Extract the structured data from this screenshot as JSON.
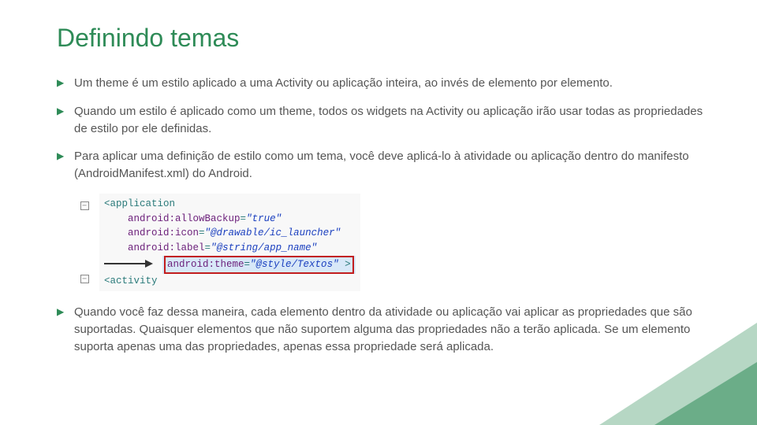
{
  "title": "Definindo temas",
  "bullets": {
    "b1": "Um theme é um estilo aplicado a uma Activity ou aplicação inteira, ao invés de elemento por elemento.",
    "b2": "Quando um estilo é aplicado como um theme, todos os widgets na Activity ou aplicação irão usar todas as propriedades de estilo por ele definidas.",
    "b3": "Para aplicar uma definição de estilo como um tema, você deve aplicá-lo à atividade ou aplicação dentro do manifesto (AndroidManifest.xml) do Android.",
    "b4": "Quando você faz dessa maneira, cada elemento dentro da atividade ou aplicação vai aplicar as propriedades que são suportadas. Quaisquer elementos que não suportem alguma das propriedades não a terão aplicada. Se um elemento suporta apenas uma das propriedades, apenas essa propriedade será aplicada."
  },
  "code": {
    "application_open": "<application",
    "allow_backup_attr": "android:allowBackup",
    "allow_backup_val": "\"true\"",
    "icon_attr": "android:icon",
    "icon_val": "\"@drawable/ic_launcher\"",
    "label_attr": "android:label",
    "label_val": "\"@string/app_name\"",
    "theme_attr": "android:theme",
    "theme_val": "\"@style/Textos\"",
    "gt": " >",
    "activity_open": "<activity"
  },
  "colors": {
    "accent": "#2E8B57",
    "highlight_border": "#c21d1d"
  }
}
